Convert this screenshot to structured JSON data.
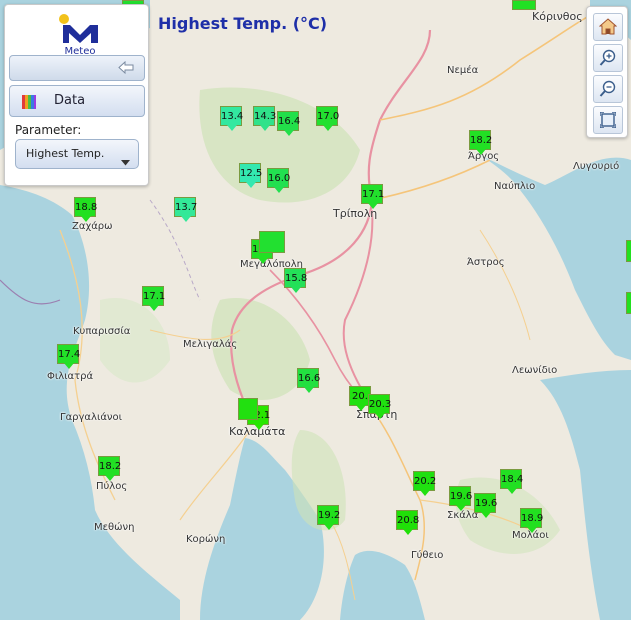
{
  "app": {
    "logo_text": "Meteo",
    "map_title": "Highest Temp. (°C)",
    "data_button_label": "Data",
    "parameter_label": "Parameter:",
    "parameter_value": "Highest Temp.",
    "toolbar": [
      "home-icon",
      "zoom-in-icon",
      "zoom-out-icon",
      "fullscreen-icon"
    ]
  },
  "place_labels": [
    {
      "name": "Κόρινθος"
    },
    {
      "name": "Νεμέα"
    },
    {
      "name": "Άργος"
    },
    {
      "name": "Λυγουριό"
    },
    {
      "name": "Ναύπλιο"
    },
    {
      "name": "Τρίπολη"
    },
    {
      "name": "Άστρος"
    },
    {
      "name": "Ζαχάρω"
    },
    {
      "name": "Μεγαλόπολη"
    },
    {
      "name": "Κυπαρισσία"
    },
    {
      "name": "Μελιγαλάς"
    },
    {
      "name": "Φιλιατρά"
    },
    {
      "name": "Λεωνίδιο"
    },
    {
      "name": "Γαργαλιάνοι"
    },
    {
      "name": "Καλαμάτα"
    },
    {
      "name": "Σπάρτη"
    },
    {
      "name": "Πύλος"
    },
    {
      "name": "Σκάλα"
    },
    {
      "name": "Μεθώνη"
    },
    {
      "name": "Κορώνη"
    },
    {
      "name": "Μολάοι"
    },
    {
      "name": "Γύθειο"
    }
  ],
  "stations": [
    {
      "value": "13.4",
      "color": "#33e8a0"
    },
    {
      "value": "14.3",
      "color": "#30e28a"
    },
    {
      "value": "16.4",
      "color": "#22e04a"
    },
    {
      "value": "17.0",
      "color": "#22e030"
    },
    {
      "value": "12.5",
      "color": "#33e8b0"
    },
    {
      "value": "16.0",
      "color": "#22e050"
    },
    {
      "value": "18.2",
      "color": "#22e024"
    },
    {
      "value": "17.1",
      "color": "#22e02c"
    },
    {
      "value": "18.8",
      "color": "#22e020"
    },
    {
      "value": "13.7",
      "color": "#33e898"
    },
    {
      "value": "18.1",
      "color": "#22e024"
    },
    {
      "value": "15.8",
      "color": "#24e058"
    },
    {
      "value": "17.1",
      "color": "#22e02c"
    },
    {
      "value": "17.4",
      "color": "#22e028"
    },
    {
      "value": "16.6",
      "color": "#22e040"
    },
    {
      "value": "20.",
      "color": "#20e010"
    },
    {
      "value": "20.3",
      "color": "#20e010"
    },
    {
      "value": "22.1",
      "color": "#28e600"
    },
    {
      "value": "18.2",
      "color": "#22e024"
    },
    {
      "value": "20.2",
      "color": "#20e010"
    },
    {
      "value": "19.6",
      "color": "#22e018"
    },
    {
      "value": "19.6",
      "color": "#22e018"
    },
    {
      "value": "18.4",
      "color": "#22e022"
    },
    {
      "value": "19.2",
      "color": "#22e01c"
    },
    {
      "value": "20.8",
      "color": "#20e008"
    },
    {
      "value": "18.9",
      "color": "#22e020"
    }
  ]
}
